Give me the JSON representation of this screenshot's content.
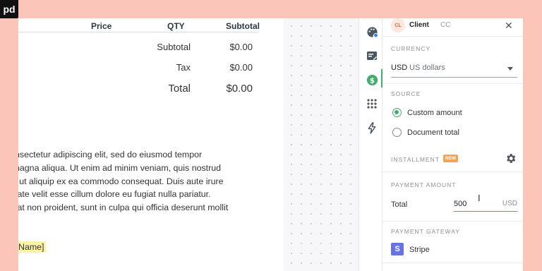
{
  "brand": {
    "logo_text": "pd"
  },
  "document": {
    "table_headers": {
      "price": "Price",
      "qty": "QTY",
      "subtotal": "Subtotal"
    },
    "totals": [
      {
        "label": "Subtotal",
        "value": "$0.00"
      },
      {
        "label": "Tax",
        "value": "$0.00"
      },
      {
        "label": "Total",
        "value": "$0.00"
      }
    ],
    "paragraph_lines": [
      "nsectetur adipiscing elit, sed do eiusmod tempor",
      "nagna aliqua. Ut enim ad minim veniam, quis nostrud",
      "i ut aliquip ex ea commodo consequat. Duis aute irure",
      "tate velit esse cillum dolore eu fugiat nulla pariatur.",
      "tat non proident, sunt in culpa qui officia deserunt mollit"
    ],
    "token_text": "Name]"
  },
  "toolbar": {
    "items": [
      "palette-icon",
      "form-icon",
      "dollar-icon",
      "apps-grid-icon",
      "lightning-icon"
    ],
    "active": "dollar-icon",
    "accent_color": "#3fae6a"
  },
  "panel": {
    "client": {
      "avatar": "CL",
      "name": "Client",
      "code": "CC"
    },
    "currency": {
      "title": "CURRENCY",
      "code": "USD",
      "name": "US dollars"
    },
    "source": {
      "title": "SOURCE",
      "options": [
        {
          "label": "Custom amount",
          "checked": true
        },
        {
          "label": "Document total",
          "checked": false
        }
      ]
    },
    "installment": {
      "title": "INSTALLMENT",
      "badge": "NEW"
    },
    "payment_amount": {
      "title": "PAYMENT AMOUNT",
      "label": "Total",
      "value": "500",
      "currency": "USD"
    },
    "payment_gateway": {
      "title": "PAYMENT GATEWAY",
      "name": "Stripe",
      "logo_letter": "S"
    }
  }
}
